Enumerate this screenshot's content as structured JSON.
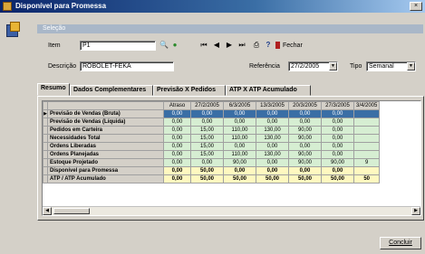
{
  "window": {
    "title": "Disponível para Promessa",
    "close_glyph": "×"
  },
  "section": {
    "header": "Seleção"
  },
  "form": {
    "item_label": "Item",
    "item_value": "P1",
    "description_label": "Descrição",
    "description_value": "ROBOLET-FEKA",
    "reference_label": "Referência",
    "reference_value": "27/2/2005",
    "type_label": "Tipo",
    "type_value": "Semanal"
  },
  "toolbar": {
    "search_glyph": "🔍",
    "go_glyph": "●",
    "first_glyph": "⏮",
    "prev_glyph": "◀",
    "next_glyph": "▶",
    "last_glyph": "⏭",
    "print_glyph": "⎙",
    "help_glyph": "?",
    "close_label": "Fechar"
  },
  "tabs": [
    {
      "label": "Resumo"
    },
    {
      "label": "Dados Complementares"
    },
    {
      "label": "Previsão X Pedidos"
    },
    {
      "label": "ATP X ATP Acumulado"
    }
  ],
  "grid": {
    "columns": [
      "Atraso",
      "27/2/2005",
      "6/3/2005",
      "13/3/2005",
      "20/3/2005",
      "27/3/2005",
      "3/4/2005"
    ],
    "rows": [
      {
        "label": "Previsão de Vendas (Bruta)",
        "values": [
          "0,00",
          "0,00",
          "0,00",
          "0,00",
          "0,00",
          "0,00",
          ""
        ],
        "style": "sel",
        "indicator": "▶"
      },
      {
        "label": "Previsão de Vendas (Líquida)",
        "values": [
          "0,00",
          "0,00",
          "0,00",
          "0,00",
          "0,00",
          "0,00",
          ""
        ],
        "style": "green",
        "indicator": ""
      },
      {
        "label": "Pedidos em Carteira",
        "values": [
          "0,00",
          "15,00",
          "110,00",
          "130,00",
          "90,00",
          "0,00",
          ""
        ],
        "style": "green",
        "indicator": ""
      },
      {
        "label": "Necessidades Total",
        "values": [
          "0,00",
          "15,00",
          "110,00",
          "130,00",
          "90,00",
          "0,00",
          ""
        ],
        "style": "green",
        "indicator": ""
      },
      {
        "label": "Ordens Liberadas",
        "values": [
          "0,00",
          "15,00",
          "0,00",
          "0,00",
          "0,00",
          "0,00",
          ""
        ],
        "style": "green",
        "indicator": ""
      },
      {
        "label": "Ordens Planejadas",
        "values": [
          "0,00",
          "15,00",
          "110,00",
          "130,00",
          "90,00",
          "0,00",
          ""
        ],
        "style": "green",
        "indicator": ""
      },
      {
        "label": "Estoque Projetado",
        "values": [
          "0,00",
          "0,00",
          "90,00",
          "0,00",
          "90,00",
          "90,00",
          "9"
        ],
        "style": "green",
        "indicator": ""
      },
      {
        "label": "Disponível para Promessa",
        "values": [
          "0,00",
          "50,00",
          "0,00",
          "0,00",
          "0,00",
          "0,00",
          ""
        ],
        "style": "yellow",
        "indicator": ""
      },
      {
        "label": "ATP / ATP Acumulado",
        "values": [
          "0,00",
          "50,00",
          "50,00",
          "50,00",
          "50,00",
          "50,00",
          "50"
        ],
        "style": "yellow",
        "indicator": ""
      }
    ]
  },
  "scroll": {
    "left_glyph": "◀",
    "right_glyph": "▶"
  },
  "footer": {
    "close_button": "Concluir"
  }
}
